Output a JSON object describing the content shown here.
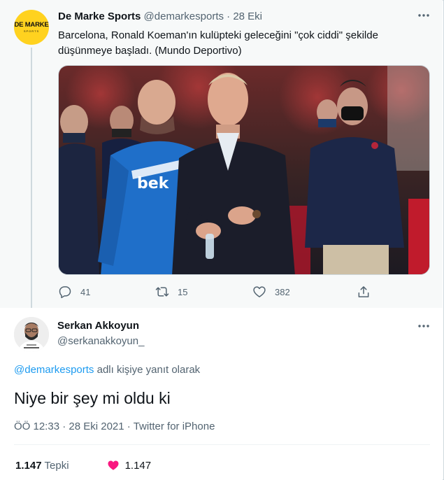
{
  "parent_tweet": {
    "avatar_text": "DE MARKE",
    "avatar_subtext": "SPORTS",
    "avatar_color": "#ffd21f",
    "author_name": "De Marke Sports",
    "author_handle": "@demarkesports",
    "separator": "·",
    "date": "28 Eki",
    "more_icon": "more-horizontal-icon",
    "text": "Barcelona, Ronald Koeman'ın kulüpteki geleceğini \"çok ciddi\" şekilde düşünmeye başladı. (Mundo Deportivo)",
    "media_text": "bek",
    "actions": {
      "reply_count": "41",
      "retweet_count": "15",
      "like_count": "382",
      "reply_icon": "reply-icon",
      "retweet_icon": "retweet-icon",
      "like_icon": "heart-icon",
      "share_icon": "share-icon"
    }
  },
  "reply_tweet": {
    "author_name": "Serkan Akkoyun",
    "author_handle": "@serkanakkoyun_",
    "replying_to_mention": "@demarkesports",
    "replying_to_suffix": " adlı kişiye yanıt olarak",
    "text": "Niye bir şey mi oldu ki",
    "time": "ÖÖ 12:33",
    "separator": "·",
    "date": "28 Eki 2021",
    "client": "Twitter for iPhone",
    "stats": {
      "reactions_count": "1.147",
      "reactions_label": "Tepki",
      "likes_count": "1.147",
      "heart_color": "#f91880"
    }
  },
  "colors": {
    "accent": "#1d9bf0",
    "secondary_text": "#536471",
    "primary_text": "#0f1419"
  }
}
